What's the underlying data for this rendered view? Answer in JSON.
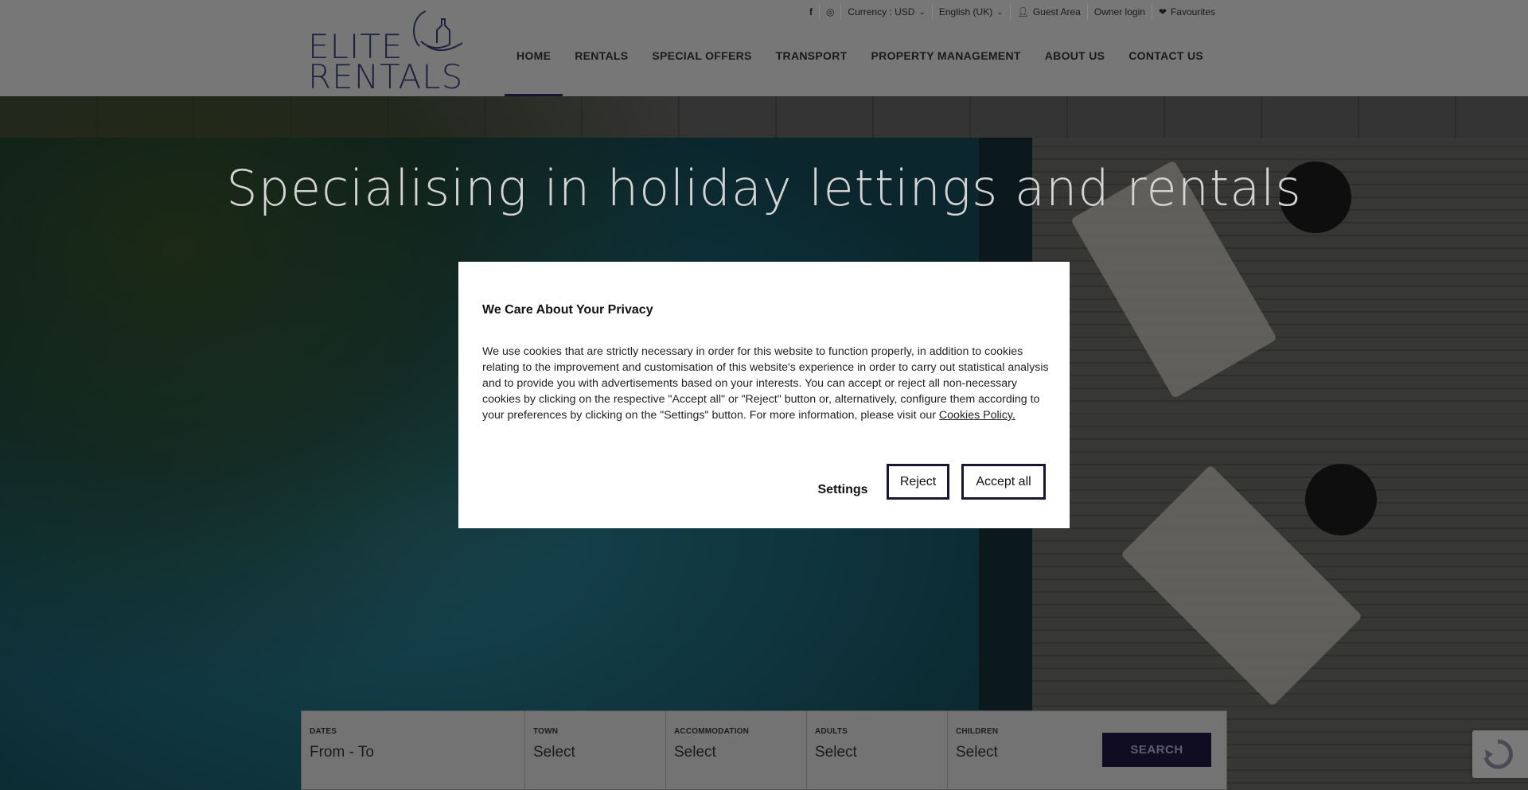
{
  "topbar": {
    "facebook_icon": "facebook-icon",
    "instagram_icon": "instagram-icon",
    "currency": "Currency : USD",
    "language": "English (UK)",
    "guest_area": "Guest Area",
    "owner_login": "Owner login",
    "favourites": "Favourites"
  },
  "logo": {
    "line1": "ELITE",
    "line2": "RENTALS"
  },
  "nav": {
    "items": [
      {
        "label": "HOME",
        "active": true
      },
      {
        "label": "RENTALS"
      },
      {
        "label": "SPECIAL OFFERS"
      },
      {
        "label": "TRANSPORT"
      },
      {
        "label": "PROPERTY MANAGEMENT"
      },
      {
        "label": "ABOUT US"
      },
      {
        "label": "CONTACT US"
      }
    ]
  },
  "hero": {
    "title": "Specialising in holiday lettings and rentals"
  },
  "search": {
    "dates_label": "DATES",
    "dates_value": "From - To",
    "town_label": "TOWN",
    "town_value": "Select",
    "accommodation_label": "ACCOMMODATION",
    "accommodation_value": "Select",
    "adults_label": "ADULTS",
    "adults_value": "Select",
    "children_label": "CHILDREN",
    "children_value": "Select",
    "button": "SEARCH"
  },
  "cookie_modal": {
    "title": "We Care About Your Privacy",
    "body": "We use cookies that are strictly necessary in order for this website to function properly, in addition to cookies relating to the improvement and customisation of this website's experience in order to carry out statistical analysis and to provide you with advertisements based on your interests. You can accept or reject all non-necessary cookies by clicking on the respective \"Accept all\" or \"Reject\" button or, alternatively, configure them according to your preferences by clicking on the \"Settings\" button. For more information, please visit our",
    "policy_link": "Cookies Policy.",
    "settings": "Settings",
    "reject": "Reject",
    "accept": "Accept all"
  },
  "colors": {
    "brand_navy": "#1b1533",
    "modal_bg": "#ffffff"
  }
}
